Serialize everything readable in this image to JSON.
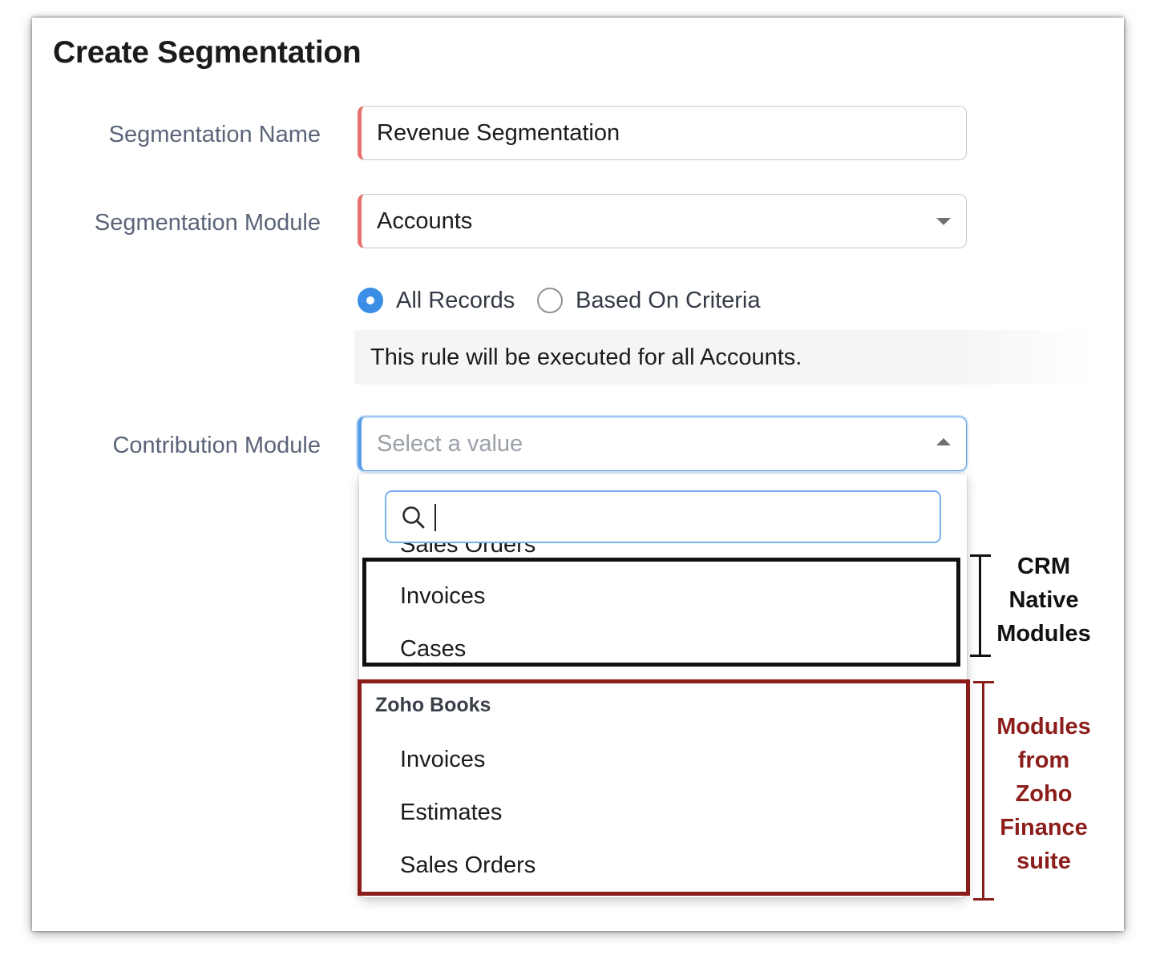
{
  "form": {
    "title": "Create Segmentation",
    "segmentation_name": {
      "label": "Segmentation Name",
      "value": "Revenue Segmentation"
    },
    "segmentation_module": {
      "label": "Segmentation Module",
      "value": "Accounts"
    },
    "records_scope": {
      "options": [
        "All Records",
        "Based On Criteria"
      ],
      "selected": "All Records"
    },
    "note": "This rule will be executed for all Accounts.",
    "contribution_module": {
      "label": "Contribution Module",
      "placeholder": "Select a value"
    }
  },
  "dropdown": {
    "search_value": "",
    "clipped_item": "Sales Orders",
    "crm_items": [
      "Invoices",
      "Cases"
    ],
    "group_header": "Zoho Books",
    "group_items": [
      "Invoices",
      "Estimates",
      "Sales Orders"
    ]
  },
  "annotations": {
    "crm": [
      "CRM",
      "Native",
      "Modules"
    ],
    "finance": [
      "Modules",
      "from",
      "Zoho",
      "Finance",
      "suite"
    ]
  },
  "colors": {
    "required_marker": "#e5736e",
    "radio_selected": "#3a8ee6",
    "focus_border": "#5b9ee8",
    "annotation_black": "#111111",
    "annotation_red": "#8b1d1a"
  },
  "icons": {
    "dropdown_caret": "chevron-down-icon",
    "dropdown_caret_open": "chevron-up-icon",
    "search": "search-icon"
  }
}
